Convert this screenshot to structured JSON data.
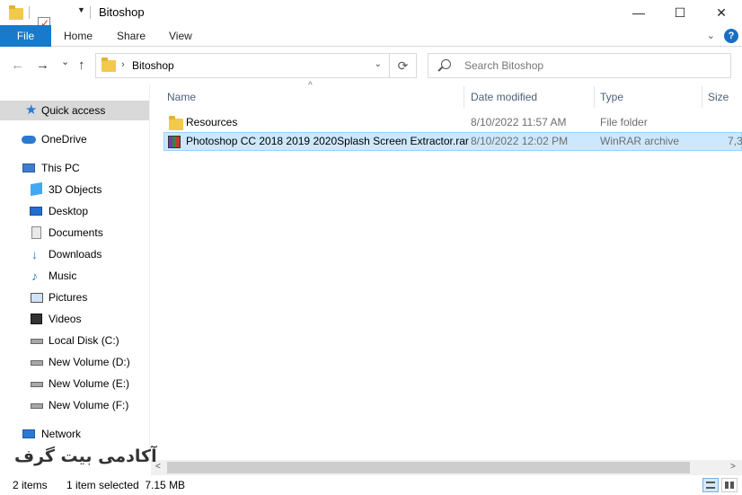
{
  "window": {
    "title": "Bitoshop",
    "minimize": "—",
    "maximize": "☐",
    "close": "✕"
  },
  "ribbon": {
    "tabs": [
      {
        "label": "File"
      },
      {
        "label": "Home"
      },
      {
        "label": "Share"
      },
      {
        "label": "View"
      }
    ],
    "expand_glyph": "⌄",
    "help_glyph": "?"
  },
  "navigation": {
    "back_glyph": "←",
    "forward_glyph": "→",
    "recent_glyph": "⌄",
    "up_glyph": "↑",
    "address_separator": "›",
    "address_path": "Bitoshop",
    "address_dropdown_glyph": "⌄",
    "refresh_glyph": "⟳",
    "search_placeholder": "Search Bitoshop"
  },
  "sidebar": {
    "items": [
      {
        "label": "Quick access",
        "icon": "star-icon",
        "selected": true
      },
      {
        "label": "OneDrive",
        "icon": "cloud-icon"
      },
      {
        "label": "This PC",
        "icon": "computer-icon"
      },
      {
        "label": "3D Objects",
        "icon": "cube-icon"
      },
      {
        "label": "Desktop",
        "icon": "desktop-icon"
      },
      {
        "label": "Documents",
        "icon": "document-icon"
      },
      {
        "label": "Downloads",
        "icon": "download-icon"
      },
      {
        "label": "Music",
        "icon": "music-icon"
      },
      {
        "label": "Pictures",
        "icon": "pictures-icon"
      },
      {
        "label": "Videos",
        "icon": "video-icon"
      },
      {
        "label": "Local Disk (C:)",
        "icon": "drive-icon"
      },
      {
        "label": "New Volume (D:)",
        "icon": "drive-icon"
      },
      {
        "label": "New Volume (E:)",
        "icon": "drive-icon"
      },
      {
        "label": "New Volume (F:)",
        "icon": "drive-icon"
      },
      {
        "label": "Network",
        "icon": "network-icon"
      }
    ]
  },
  "file_list": {
    "columns": {
      "name": "Name",
      "date_modified": "Date modified",
      "type": "Type",
      "size": "Size"
    },
    "sort_glyph": "^",
    "rows": [
      {
        "name": "Resources",
        "date": "8/10/2022 11:57 AM",
        "type": "File folder",
        "size": "",
        "icon": "folder-icon",
        "selected": false
      },
      {
        "name": "Photoshop CC 2018 2019 2020Splash Screen Extractor.rar",
        "date": "8/10/2022 12:02 PM",
        "type": "WinRAR archive",
        "size": "7,3",
        "icon": "winrar-archive-icon",
        "selected": true
      }
    ]
  },
  "scrollbar": {
    "left_glyph": "<",
    "right_glyph": ">"
  },
  "watermark": "آکادمی بیت گرف",
  "status": {
    "item_count": "2 items",
    "selection": "1 item selected  7.15 MB"
  },
  "colors": {
    "accent": "#1979ca",
    "selection_bg": "#cce8ff",
    "selection_border": "#99d1ff",
    "sidebar_selected": "#d9d9d9"
  }
}
